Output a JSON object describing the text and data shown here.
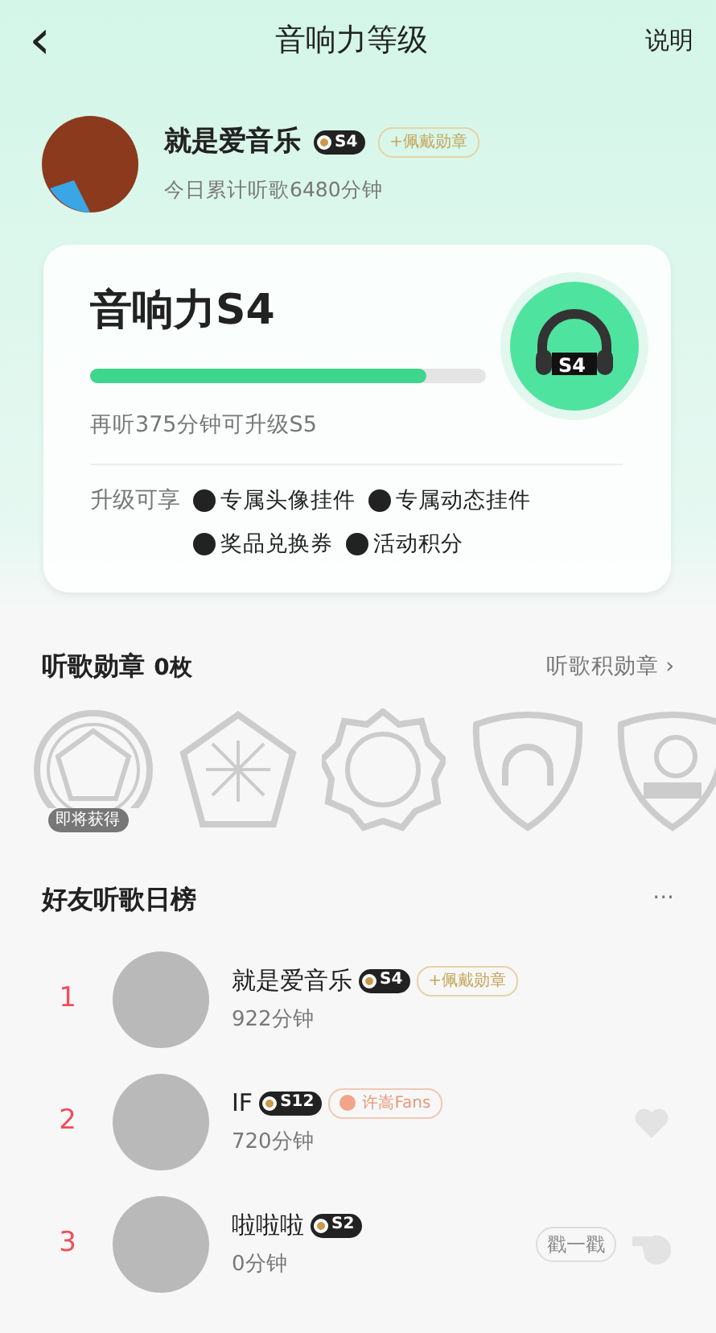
{
  "header": {
    "back": "‹",
    "title": "音响力等级",
    "help": "说明"
  },
  "profile": {
    "name": "就是爱音乐",
    "level": "S4",
    "tag": {
      "kind": "wear",
      "text": "+佩戴勋章"
    },
    "today": "今日累计听歌6480分钟"
  },
  "level_card": {
    "title": "音响力S4",
    "level": 0.85,
    "hint": "再听375分钟可升级S5",
    "badge": "S4",
    "perks_label": "升级可享",
    "perks": [
      "专属头像挂件",
      "专属动态挂件",
      "奖品兑换券",
      "活动积分"
    ]
  },
  "medals": {
    "title": "听歌勋章",
    "count": "0枚",
    "link": "听歌积勋章",
    "more": "›",
    "items": [
      {
        "kind": "circle",
        "label": "即将获得"
      },
      {
        "kind": "pentagon"
      },
      {
        "kind": "gear"
      },
      {
        "kind": "shield"
      },
      {
        "kind": "gramophone"
      }
    ]
  },
  "ranking": {
    "title": "好友听歌日榜",
    "more": "···",
    "rows": [
      {
        "rank": "1",
        "name": "就是爱音乐",
        "level": "S4",
        "tag": {
          "kind": "wear",
          "text": "+佩戴勋章"
        },
        "minutes": "922分钟"
      },
      {
        "rank": "2",
        "name": "IF",
        "level": "S12",
        "tag": {
          "kind": "fans",
          "text": "许嵩Fans"
        },
        "minutes": "720分钟",
        "action": {
          "kind": "like"
        }
      },
      {
        "rank": "3",
        "name": "啦啦啦",
        "level": "S2",
        "minutes": "0分钟",
        "action": {
          "kind": "poke",
          "text": "戳一戳"
        }
      }
    ]
  }
}
